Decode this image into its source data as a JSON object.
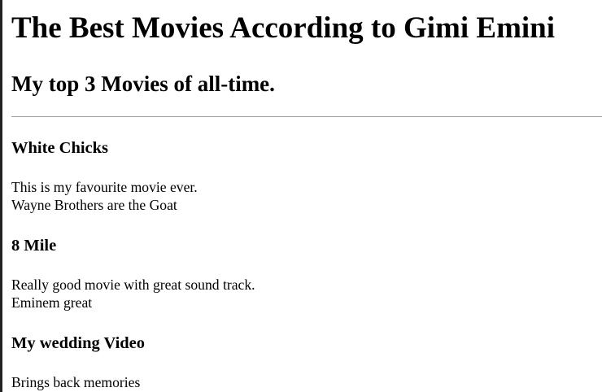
{
  "title": "The Best Movies According to Gimi Emini",
  "subtitle": "My top 3 Movies of all-time.",
  "movies": [
    {
      "name": "White Chicks",
      "lines": [
        "This is my favourite movie ever.",
        "Wayne Brothers are the Goat"
      ]
    },
    {
      "name": "8 Mile",
      "lines": [
        "Really good movie with great sound track.",
        "Eminem great"
      ]
    },
    {
      "name": "My wedding Video",
      "lines": [
        "Brings back memories"
      ]
    }
  ]
}
